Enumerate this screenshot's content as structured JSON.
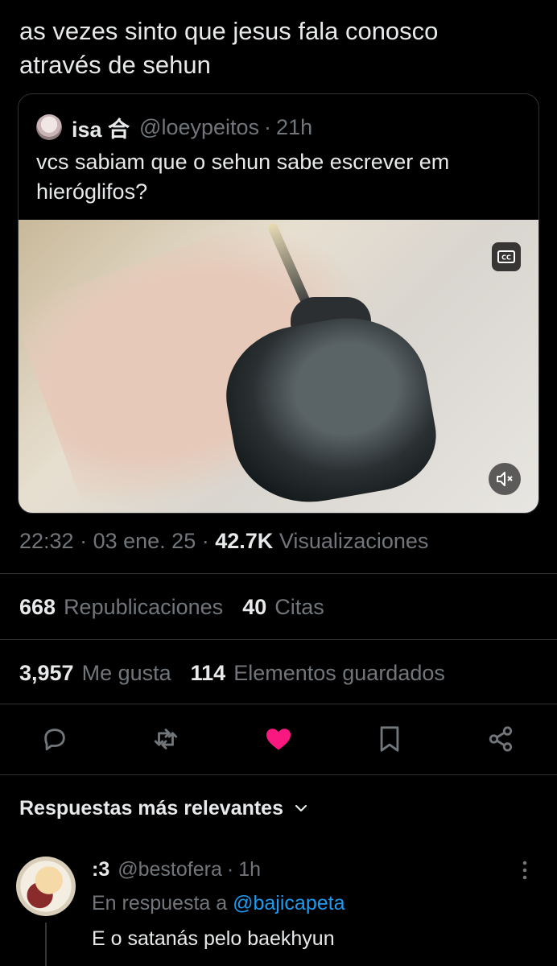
{
  "tweet": {
    "text_line1": "as vezes sinto que jesus fala conosco",
    "text_line2": "através de sehun"
  },
  "quote": {
    "name": "isa 合",
    "handle": "@loeypeitos",
    "time": "21h",
    "text_line1": "vcs sabiam que o sehun sabe escrever em",
    "text_line2": "hieróglifos?",
    "media": {
      "cc_icon": "closed-captions-icon",
      "mute_icon": "volume-muted-icon"
    }
  },
  "meta": {
    "time": "22:32",
    "date": "03 ene. 25",
    "views_count": "42.7K",
    "views_label": "Visualizaciones"
  },
  "stats": {
    "reposts_count": "668",
    "reposts_label": "Republicaciones",
    "quotes_count": "40",
    "quotes_label": "Citas",
    "likes_count": "3,957",
    "likes_label": "Me gusta",
    "bookmarks_count": "114",
    "bookmarks_label": "Elementos guardados"
  },
  "actions": {
    "icons": [
      "reply-icon",
      "repost-icon",
      "like-icon",
      "bookmark-icon",
      "share-icon"
    ],
    "like_color": "#f91880"
  },
  "replies": {
    "header": "Respuestas más relevantes",
    "header_icon": "chevron-down-icon",
    "items": [
      {
        "name": ":3",
        "handle": "@bestofera",
        "time": "1h",
        "reply_to_label": "En respuesta a",
        "reply_to_handle": "@bajicapeta",
        "text": "E o satanás pelo baekhyun"
      }
    ]
  },
  "colors": {
    "background": "#000000",
    "text": "#e7e9ea",
    "secondary": "#71767b",
    "link": "#1d9bf0",
    "divider": "#2f3336"
  }
}
